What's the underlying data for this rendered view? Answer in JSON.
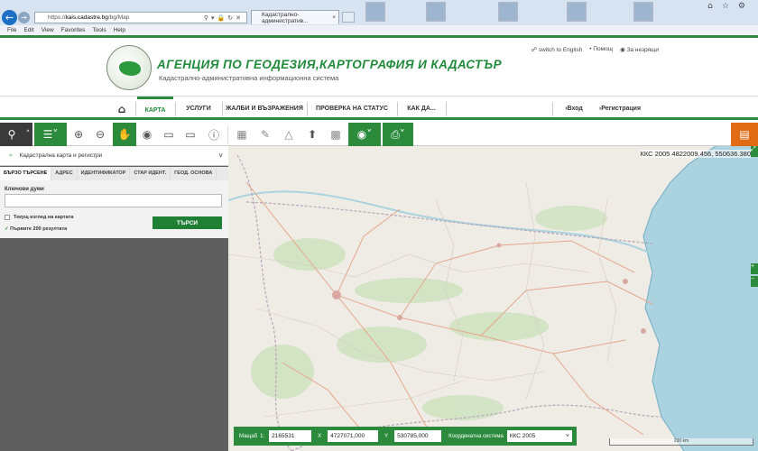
{
  "browser": {
    "url_prefix": "https://",
    "url_host": "kais.cadastre.bg",
    "url_path": "/bg/Map",
    "tab_title": "Кадастрално-административ...",
    "tab_close": "×",
    "menu": [
      "File",
      "Edit",
      "View",
      "Favorites",
      "Tools",
      "Help"
    ]
  },
  "header": {
    "title": "АГЕНЦИЯ ПО ГЕОДЕЗИЯ,КАРТОГРАФИЯ И КАДАСТЪР",
    "subtitle": "Кадастрално-административна информационна система",
    "links": [
      "switch to English",
      "Помощ",
      "За незрящи"
    ]
  },
  "nav": {
    "items": [
      "КАРТА",
      "УСЛУГИ",
      "ЖАЛБИ И ВЪЗРАЖЕНИЯ",
      "ПРОВЕРКА НА СТАТУС",
      "КАК ДА..."
    ],
    "login": "Вход",
    "register": "Регистрация"
  },
  "panel": {
    "header": "Кадастрална карта и регистри",
    "tabs": [
      "БЪРЗО ТЪРСЕНЕ",
      "АДРЕС",
      "ИДЕНТИФИКАТОР",
      "СТАР ИДЕНТ.",
      "ГЕОД. ОСНОВА"
    ],
    "keywords_label": "Ключови думи",
    "keywords_value": "",
    "current_view_label": "Текущ изглед на картата",
    "first_results_label": "Първите 200 резултата",
    "search_button": "ТЪРСИ"
  },
  "map": {
    "coords_text": "ККС 2005 4822009.456, 550636.380",
    "scale_label": "Мащаб",
    "scale_one": "1:",
    "scale_value": "2165531",
    "x_label": "X",
    "x_value": "4727071,000",
    "y_label": "Y",
    "y_value": "530785,000",
    "crs_label": "Координатна система",
    "crs_value": "ККС 2005",
    "scalebar": "200 km",
    "colors": {
      "land": "#efece6",
      "sea": "#aad3df",
      "forest": "#cfe3c0",
      "road": "#e8a68a"
    }
  },
  "colors": {
    "accent": "#2c8a3d",
    "orange": "#e06b12"
  }
}
